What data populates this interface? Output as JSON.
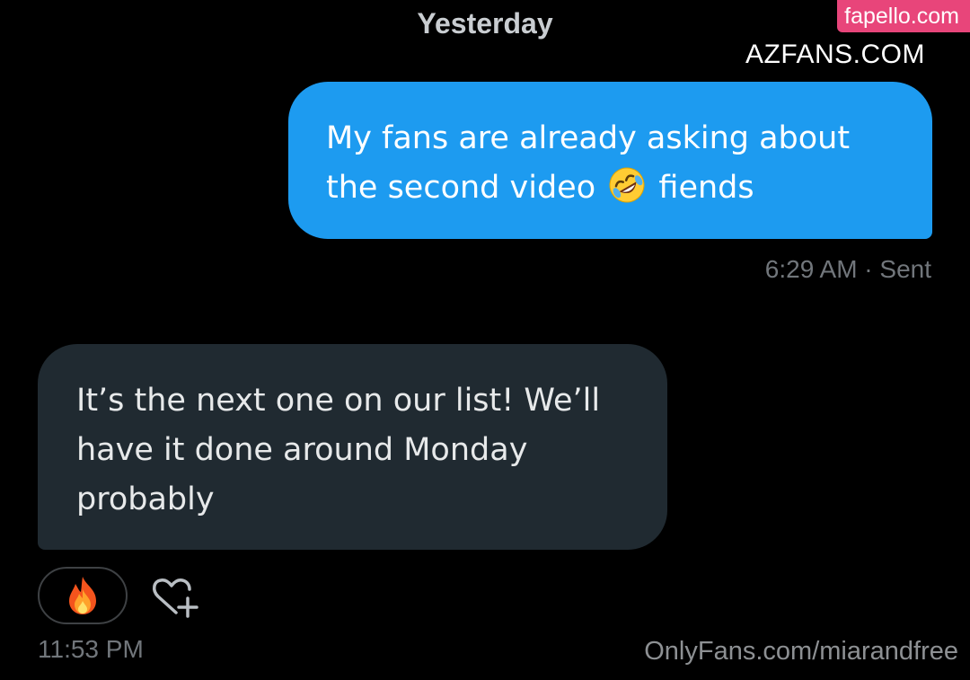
{
  "conversation": {
    "date_separator": "Yesterday",
    "messages": [
      {
        "direction": "sent",
        "text_before_emoji": "My fans are already asking about the second video",
        "emoji": "rolling-on-floor-laughing-emoji",
        "text_after_emoji": "fiends",
        "timestamp": "6:29 AM · Sent",
        "bubble_color": "#1d9bf0"
      },
      {
        "direction": "received",
        "text": "It’s the next one on our list! We’ll have it done around Monday probably",
        "reaction_icon": "fire-emoji",
        "add_reaction_icon": "heart-plus-icon",
        "timestamp": "11:53 PM",
        "bubble_color": "#202a31"
      }
    ]
  },
  "watermarks": {
    "top_right_badge": "fapello.com",
    "top_right_text": "AZFANS.COM",
    "bottom_right_text": "OnlyFans.com/miarandfree"
  },
  "colors": {
    "background": "#000000",
    "sent_bubble": "#1d9bf0",
    "received_bubble": "#202a31",
    "meta_text": "#71767b",
    "fapello_badge": "#e8457a"
  }
}
